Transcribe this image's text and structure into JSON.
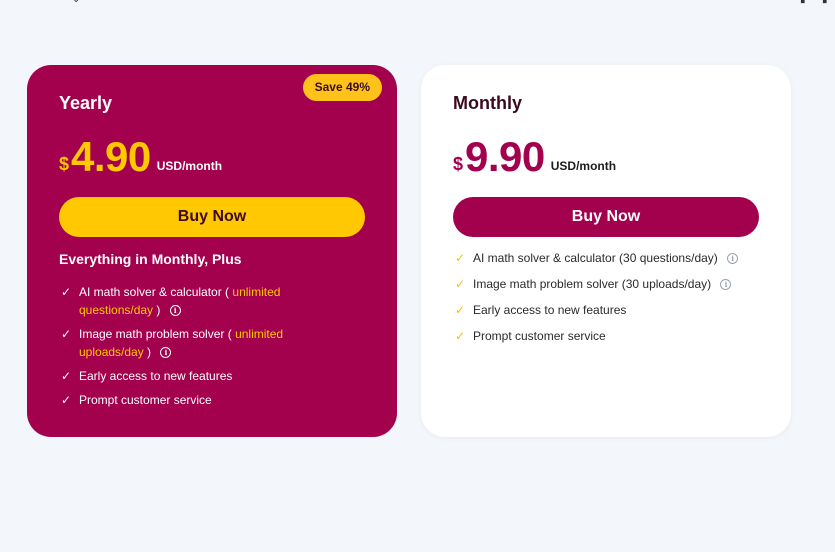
{
  "top_icons": [
    "chevron-icon",
    "tablet-icon",
    "tablet-icon"
  ],
  "colors": {
    "background": "#f3f7fb",
    "primary": "#a3004e",
    "accent": "#ffc800",
    "card_white": "#ffffff"
  },
  "yearly": {
    "name": "Yearly",
    "badge": "Save 49%",
    "currency": "$",
    "amount": "4.90",
    "unit": "USD/month",
    "button": "Buy Now",
    "heading": "Everything in Monthly, Plus",
    "features": [
      {
        "before": "AI math solver & calculator ( ",
        "highlight": "unlimited questions/day",
        "after": " )",
        "info": true
      },
      {
        "before": "Image math problem solver ( ",
        "highlight": "unlimited uploads/day",
        "after": " )",
        "info": true
      },
      {
        "before": "Early access to new features",
        "highlight": "",
        "after": "",
        "info": false
      },
      {
        "before": "Prompt customer service",
        "highlight": "",
        "after": "",
        "info": false
      }
    ]
  },
  "monthly": {
    "name": "Monthly",
    "currency": "$",
    "amount": "9.90",
    "unit": "USD/month",
    "button": "Buy Now",
    "features": [
      {
        "text": "AI math solver & calculator (30 questions/day)",
        "info": true
      },
      {
        "text": "Image math problem solver (30 uploads/day)",
        "info": true
      },
      {
        "text": "Early access to new features",
        "info": false
      },
      {
        "text": "Prompt customer service",
        "info": false
      }
    ]
  },
  "glyphs": {
    "check": "✓",
    "info": "i"
  }
}
